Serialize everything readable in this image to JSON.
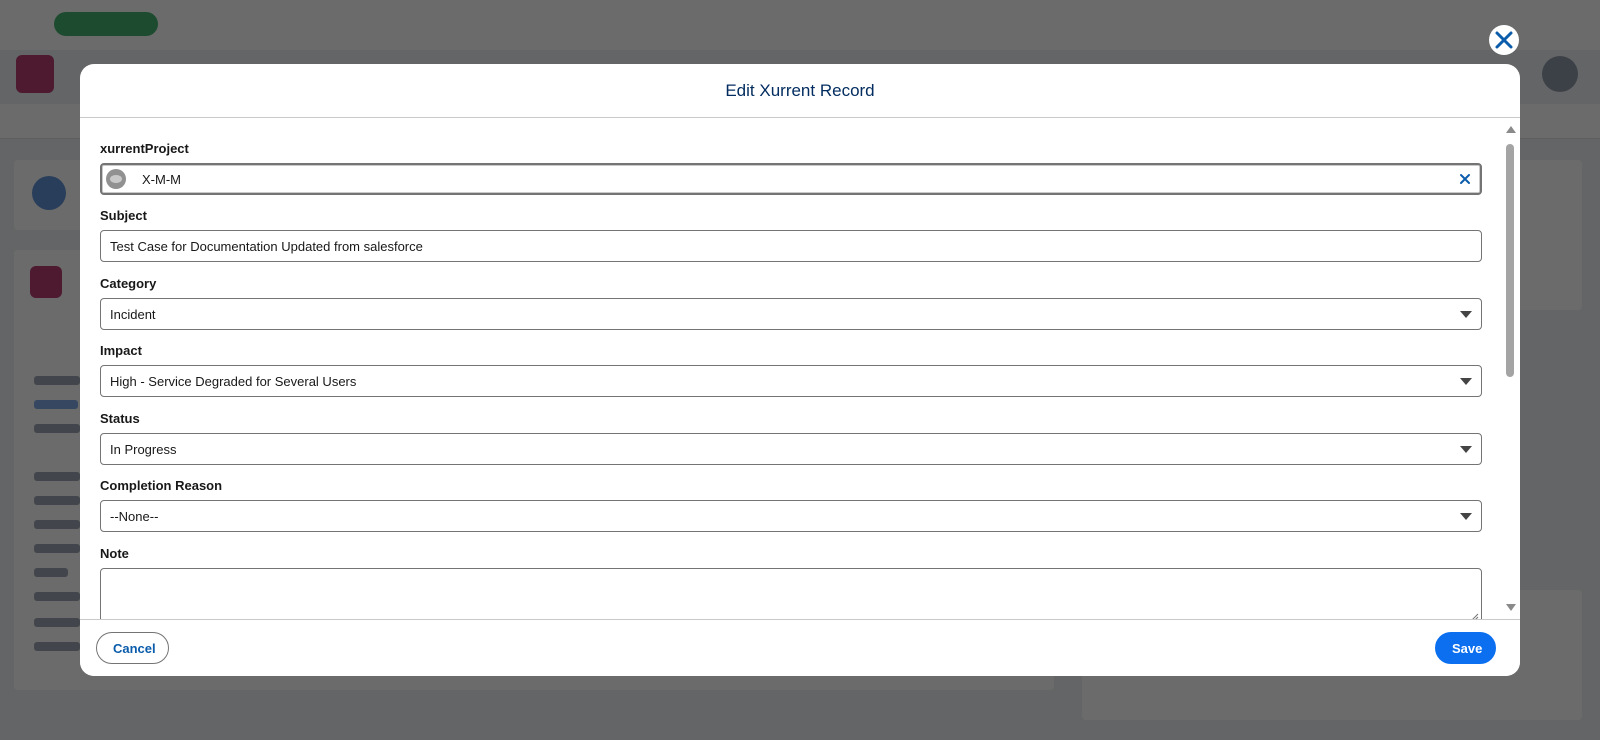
{
  "modal": {
    "title": "Edit Xurrent Record"
  },
  "form": {
    "xurrent_project": {
      "label": "xurrentProject",
      "value": "X-M-M"
    },
    "subject": {
      "label": "Subject",
      "value": "Test Case for Documentation Updated from salesforce"
    },
    "category": {
      "label": "Category",
      "value": "Incident"
    },
    "impact": {
      "label": "Impact",
      "value": "High - Service Degraded for Several Users"
    },
    "status": {
      "label": "Status",
      "value": "In Progress"
    },
    "completion_reason": {
      "label": "Completion Reason",
      "value": "--None--"
    },
    "note": {
      "label": "Note",
      "value": ""
    }
  },
  "footer": {
    "cancel_label": "Cancel",
    "save_label": "Save"
  },
  "icons": {
    "close": "close-icon",
    "lookup_record": "record-icon",
    "clear": "clear-icon",
    "dropdown": "chevron-down-icon"
  },
  "colors": {
    "brand_blue": "#0b6ff0",
    "title_navy": "#032d60",
    "link_blue": "#0b5cab"
  }
}
